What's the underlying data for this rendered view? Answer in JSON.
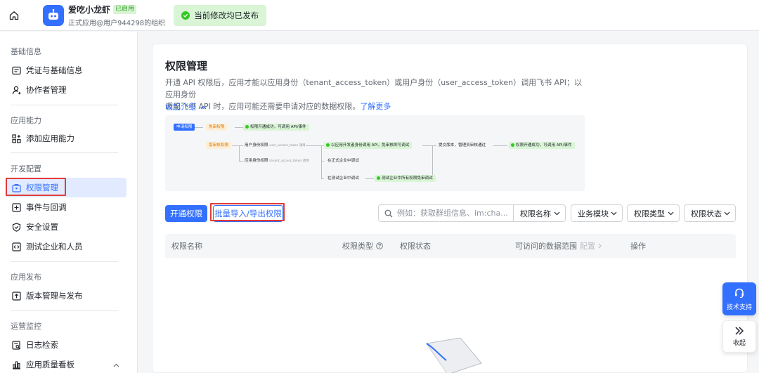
{
  "header": {
    "app_name": "爱吃小龙虾",
    "app_tag": "已启用",
    "app_sub": "正式应用@用户944298的组织",
    "publish_status": "当前修改均已发布"
  },
  "sidebar": {
    "sections": [
      {
        "title": "基础信息",
        "items": [
          {
            "label": "凭证与基础信息",
            "icon": "credential-icon"
          },
          {
            "label": "协作者管理",
            "icon": "user-icon"
          }
        ]
      },
      {
        "title": "应用能力",
        "items": [
          {
            "label": "添加应用能力",
            "icon": "grid-add-icon"
          }
        ]
      },
      {
        "title": "开发配置",
        "items": [
          {
            "label": "权限管理",
            "icon": "permission-icon",
            "active": true
          },
          {
            "label": "事件与回调",
            "icon": "event-icon"
          },
          {
            "label": "安全设置",
            "icon": "shield-icon"
          },
          {
            "label": "测试企业和人员",
            "icon": "code-icon"
          }
        ]
      },
      {
        "title": "应用发布",
        "items": [
          {
            "label": "版本管理与发布",
            "icon": "upload-icon"
          }
        ]
      },
      {
        "title": "运营监控",
        "items": [
          {
            "label": "日志检索",
            "icon": "log-icon"
          },
          {
            "label": "应用质量看板",
            "icon": "chart-icon"
          }
        ]
      }
    ]
  },
  "main": {
    "title": "权限管理",
    "desc_line1": "开通 API 权限后，应用才能以应用身份（tenant_access_token）或用户身份（user_access_token）调用飞书 API；以应用身份",
    "desc_line2": "调用飞书 API 时，应用可能还需要申请对应的数据权限。",
    "learn_more": "了解更多",
    "collapse_label": "收起介绍",
    "flow": {
      "apply": "申请权限",
      "no_review": "免审权限",
      "open_success": "权限开通成功，可调用 API/事件",
      "need_review": "需审核权限",
      "user_perm": "用户身份权限",
      "user_token": "user_access_token 调用",
      "as_dev": "以应用开发者身份调用 API，免审核即可调试",
      "submit": "提交版本，管理员审核通过",
      "open_success2": "权限开通成功，可调用 API/事件",
      "app_perm": "应用身份权限",
      "tenant_token": "tenant_access_token 调用",
      "in_prod": "在正式企业中调试",
      "in_test": "在测试企业中调试",
      "test_all": "测试企业中所有权限免审调试"
    },
    "btn_open": "开通权限",
    "btn_batch": "批量导入/导出权限",
    "search_placeholder": "例如：获取群组信息、im:cha...",
    "filters": {
      "name": "权限名称",
      "module": "业务模块",
      "type": "权限类型",
      "status": "权限状态"
    },
    "table_headers": {
      "name": "权限名称",
      "type": "权限类型",
      "status": "权限状态",
      "scope": "可访问的数据范围",
      "config": "配置",
      "action": "操作"
    }
  },
  "float": {
    "support": "技术支持",
    "collapse": "收起"
  },
  "colors": {
    "accent": "#3370ff",
    "highlight": "#e23c39",
    "success": "#34c724"
  }
}
